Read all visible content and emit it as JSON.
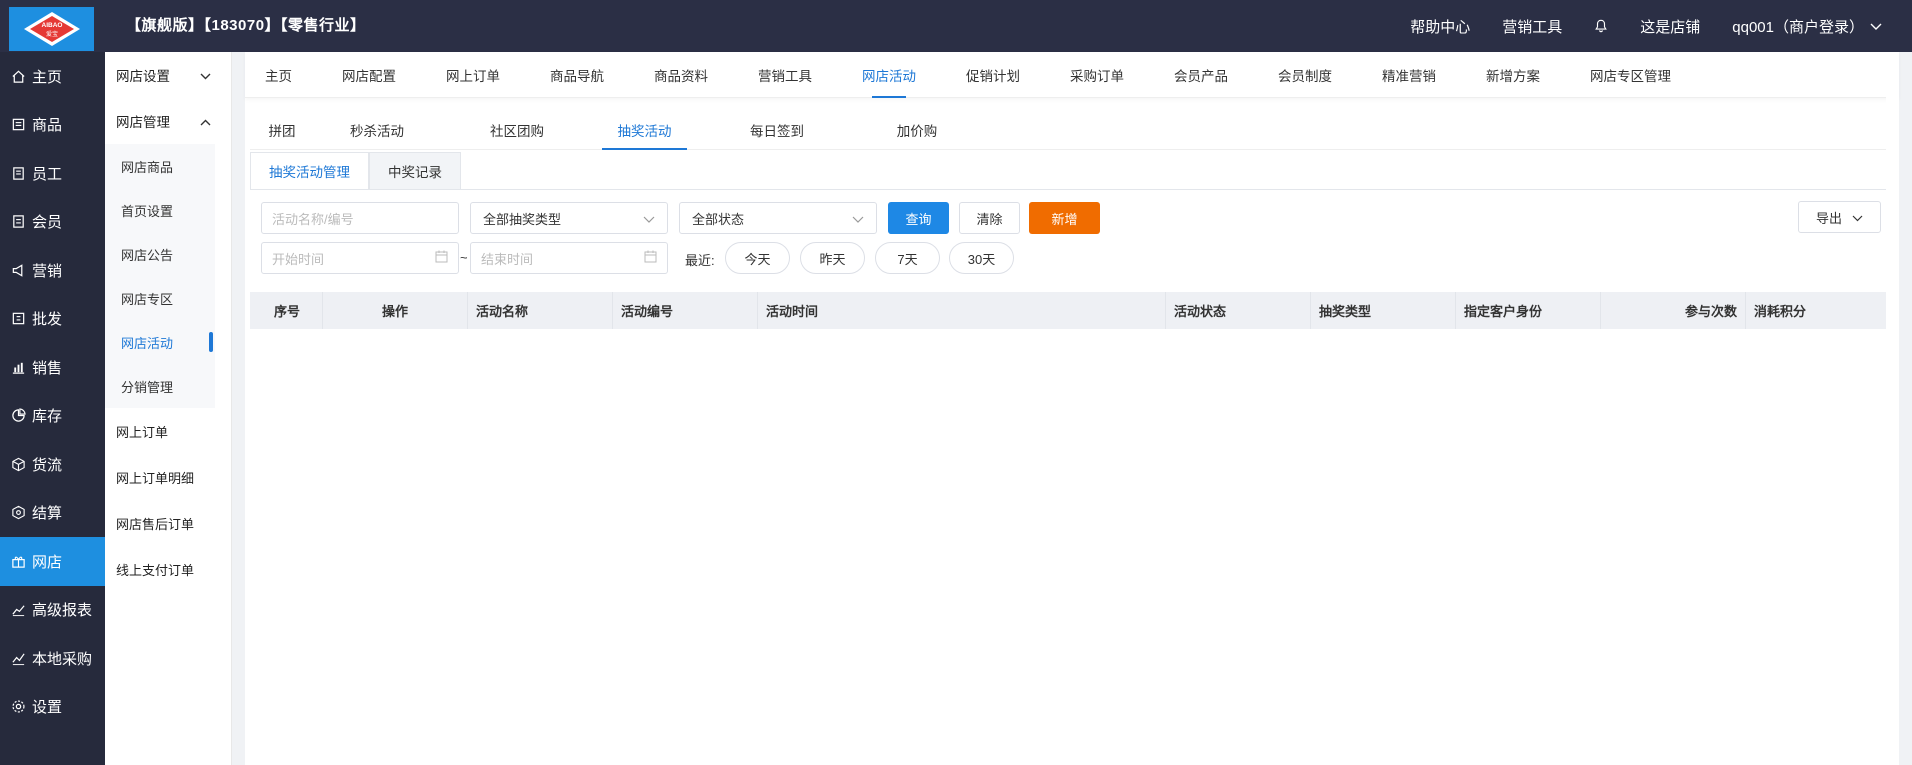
{
  "header": {
    "logo_text_top": "AIBAO",
    "logo_text_bottom": "爱宝",
    "company": "【旗舰版】【183070】【零售行业】",
    "help": "帮助中心",
    "marketing": "营销工具",
    "shop": "这是店铺",
    "user": "qq001（商户登录）"
  },
  "mainnav": {
    "items": [
      {
        "label": "主页",
        "icon": "home-icon"
      },
      {
        "label": "商品",
        "icon": "product-icon"
      },
      {
        "label": "员工",
        "icon": "staff-icon"
      },
      {
        "label": "会员",
        "icon": "member-icon"
      },
      {
        "label": "营销",
        "icon": "megaphone-icon"
      },
      {
        "label": "批发",
        "icon": "wholesale-icon"
      },
      {
        "label": "销售",
        "icon": "chart-icon"
      },
      {
        "label": "库存",
        "icon": "pie-icon"
      },
      {
        "label": "货流",
        "icon": "cube-icon"
      },
      {
        "label": "结算",
        "icon": "settle-icon"
      },
      {
        "label": "网店",
        "icon": "gift-icon"
      },
      {
        "label": "高级报表",
        "icon": "line-chart-icon"
      },
      {
        "label": "本地采购",
        "icon": "trend-icon"
      },
      {
        "label": "设置",
        "icon": "gear-icon"
      }
    ]
  },
  "subnav": {
    "group1": "网店设置",
    "group2": "网店管理",
    "subitems": [
      "网店商品",
      "首页设置",
      "网店公告",
      "网店专区",
      "网店活动",
      "分销管理"
    ],
    "plain": [
      "网上订单",
      "网上订单明细",
      "网店售后订单",
      "线上支付订单"
    ]
  },
  "tabs1": [
    "主页",
    "网店配置",
    "网上订单",
    "商品导航",
    "商品资料",
    "营销工具",
    "网店活动",
    "促销计划",
    "采购订单",
    "会员产品",
    "会员制度",
    "精准营销",
    "新增方案",
    "网店专区管理"
  ],
  "tabs2": [
    "拼团",
    "秒杀活动",
    "社区团购",
    "抽奖活动",
    "每日签到",
    "加价购"
  ],
  "tabs3": [
    "抽奖活动管理",
    "中奖记录"
  ],
  "filters": {
    "name_placeholder": "活动名称/编号",
    "type_value": "全部抽奖类型",
    "status_value": "全部状态",
    "query": "查询",
    "clear": "清除",
    "add": "新增",
    "export": "导出",
    "start_placeholder": "开始时间",
    "tilde": "~",
    "end_placeholder": "结束时间",
    "recent_label": "最近:",
    "today": "今天",
    "yesterday": "昨天",
    "days7": "7天",
    "days30": "30天"
  },
  "table": {
    "columns": [
      "序号",
      "操作",
      "活动名称",
      "活动编号",
      "活动时间",
      "活动状态",
      "抽奖类型",
      "指定客户身份",
      "参与次数",
      "消耗积分"
    ]
  },
  "colors": {
    "header_bg": "#2b2f45",
    "nav_bg": "#262a3c",
    "accent": "#1e8fe0",
    "warn": "#f06c00"
  }
}
